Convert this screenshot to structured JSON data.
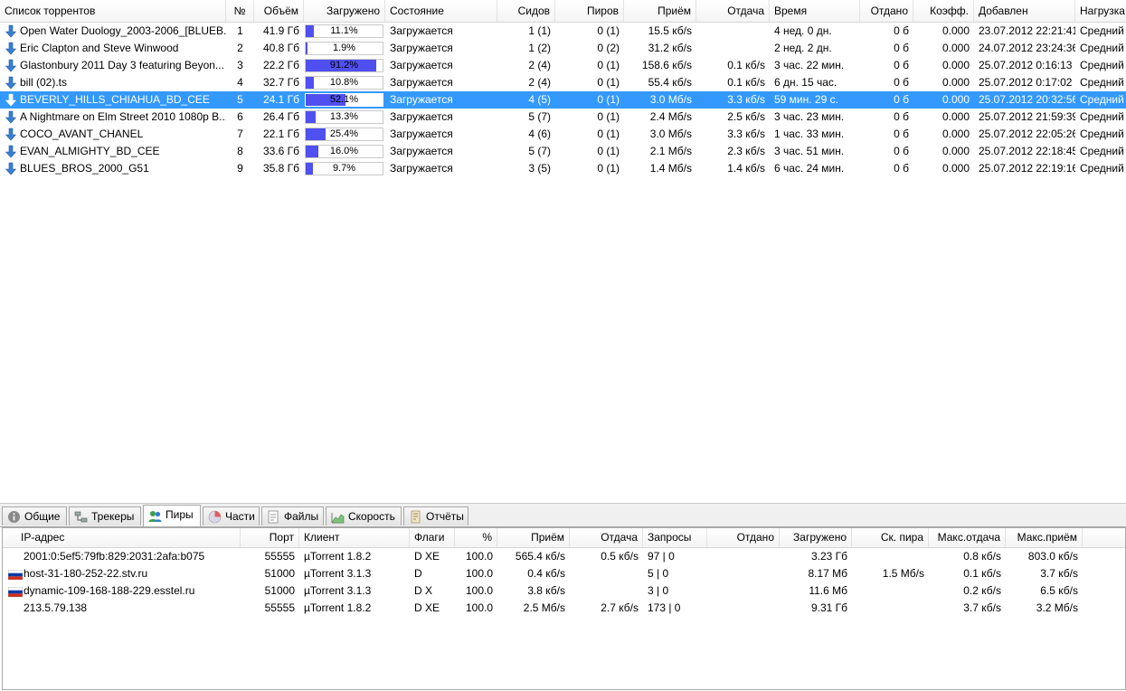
{
  "torrents": {
    "columns": {
      "name": "Список торрентов",
      "num": "№",
      "size": "Объём",
      "done": "Загружено",
      "status": "Состояние",
      "seeds": "Сидов",
      "peers": "Пиров",
      "down": "Приём",
      "up": "Отдача",
      "eta": "Время",
      "uploaded": "Отдано",
      "ratio": "Коэфф.",
      "added": "Добавлен",
      "load": "Нагрузка"
    },
    "rows": [
      {
        "name": "Open Water Duology_2003-2006_[BLUEB...",
        "num": "1",
        "size": "41.9 Гб",
        "progress": 11.1,
        "done": "11.1%",
        "status": "Загружается",
        "seeds": "1 (1)",
        "peers": "0 (1)",
        "down": "15.5 кб/s",
        "up": "",
        "eta": "4 нед. 0 дн.",
        "uploaded": "0 б",
        "ratio": "0.000",
        "added": "23.07.2012 22:21:41",
        "load": "Средний"
      },
      {
        "name": "Eric Clapton and Steve Winwood",
        "num": "2",
        "size": "40.8 Гб",
        "progress": 1.9,
        "done": "1.9%",
        "status": "Загружается",
        "seeds": "1 (2)",
        "peers": "0 (2)",
        "down": "31.2 кб/s",
        "up": "",
        "eta": "2 нед. 2 дн.",
        "uploaded": "0 б",
        "ratio": "0.000",
        "added": "24.07.2012 23:24:36",
        "load": "Средний"
      },
      {
        "name": "Glastonbury 2011 Day 3 featuring Beyon...",
        "num": "3",
        "size": "22.2 Гб",
        "progress": 91.2,
        "done": "91.2%",
        "status": "Загружается",
        "seeds": "2 (4)",
        "peers": "0 (1)",
        "down": "158.6 кб/s",
        "up": "0.1 кб/s",
        "eta": "3 час. 22 мин.",
        "uploaded": "0 б",
        "ratio": "0.000",
        "added": "25.07.2012 0:16:13",
        "load": "Средний"
      },
      {
        "name": "bill (02).ts",
        "num": "4",
        "size": "32.7 Гб",
        "progress": 10.8,
        "done": "10.8%",
        "status": "Загружается",
        "seeds": "2 (4)",
        "peers": "0 (1)",
        "down": "55.4 кб/s",
        "up": "0.1 кб/s",
        "eta": "6 дн. 15 час.",
        "uploaded": "0 б",
        "ratio": "0.000",
        "added": "25.07.2012 0:17:02",
        "load": "Средний"
      },
      {
        "name": "BEVERLY_HILLS_CHIAHUA_BD_CEE",
        "num": "5",
        "size": "24.1 Гб",
        "progress": 52.1,
        "done": "52.1%",
        "status": "Загружается",
        "seeds": "4 (5)",
        "peers": "0 (1)",
        "down": "3.0 Мб/s",
        "up": "3.3 кб/s",
        "eta": "59 мин. 29 с.",
        "uploaded": "0 б",
        "ratio": "0.000",
        "added": "25.07.2012 20:32:56",
        "load": "Средний",
        "selected": true
      },
      {
        "name": "A Nightmare on Elm Street 2010 1080p B...",
        "num": "6",
        "size": "26.4 Гб",
        "progress": 13.3,
        "done": "13.3%",
        "status": "Загружается",
        "seeds": "5 (7)",
        "peers": "0 (1)",
        "down": "2.4 Мб/s",
        "up": "2.5 кб/s",
        "eta": "3 час. 23 мин.",
        "uploaded": "0 б",
        "ratio": "0.000",
        "added": "25.07.2012 21:59:39",
        "load": "Средний"
      },
      {
        "name": "COCO_AVANT_CHANEL",
        "num": "7",
        "size": "22.1 Гб",
        "progress": 25.4,
        "done": "25.4%",
        "status": "Загружается",
        "seeds": "4 (6)",
        "peers": "0 (1)",
        "down": "3.0 Мб/s",
        "up": "3.3 кб/s",
        "eta": "1 час. 33 мин.",
        "uploaded": "0 б",
        "ratio": "0.000",
        "added": "25.07.2012 22:05:26",
        "load": "Средний"
      },
      {
        "name": "EVAN_ALMIGHTY_BD_CEE",
        "num": "8",
        "size": "33.6 Гб",
        "progress": 16.0,
        "done": "16.0%",
        "status": "Загружается",
        "seeds": "5 (7)",
        "peers": "0 (1)",
        "down": "2.1 Мб/s",
        "up": "2.3 кб/s",
        "eta": "3 час. 51 мин.",
        "uploaded": "0 б",
        "ratio": "0.000",
        "added": "25.07.2012 22:18:45",
        "load": "Средний"
      },
      {
        "name": "BLUES_BROS_2000_G51",
        "num": "9",
        "size": "35.8 Гб",
        "progress": 9.7,
        "done": "9.7%",
        "status": "Загружается",
        "seeds": "3 (5)",
        "peers": "0 (1)",
        "down": "1.4 Мб/s",
        "up": "1.4 кб/s",
        "eta": "6 час. 24 мин.",
        "uploaded": "0 б",
        "ratio": "0.000",
        "added": "25.07.2012 22:19:16",
        "load": "Средний"
      }
    ]
  },
  "tabs": [
    {
      "label": "Общие",
      "icon": "info-icon"
    },
    {
      "label": "Трекеры",
      "icon": "network-icon"
    },
    {
      "label": "Пиры",
      "icon": "users-icon",
      "active": true
    },
    {
      "label": "Части",
      "icon": "pie-icon"
    },
    {
      "label": "Файлы",
      "icon": "folder-icon"
    },
    {
      "label": "Скорость",
      "icon": "speed-graph-icon"
    },
    {
      "label": "Отчёты",
      "icon": "log-icon"
    }
  ],
  "peers": {
    "columns": {
      "ip": "IP-адрес",
      "port": "Порт",
      "client": "Клиент",
      "flags": "Флаги",
      "pct": "%",
      "down": "Приём",
      "up": "Отдача",
      "reqs": "Запросы",
      "uploaded": "Отдано",
      "downloaded": "Загружено",
      "peer_speed": "Ск. пира",
      "max_up": "Макс.отдача",
      "max_down": "Макс.приём"
    },
    "rows": [
      {
        "flag": "",
        "ip": "2001:0:5ef5:79fb:829:2031:2afa:b075",
        "port": "55555",
        "client": "µTorrent 1.8.2",
        "flags": "D XE",
        "pct": "100.0",
        "down": "565.4 кб/s",
        "up": "0.5 кб/s",
        "reqs": "97 | 0",
        "uploaded": "",
        "downloaded": "3.23 Гб",
        "peer_speed": "",
        "max_up": "0.8 кб/s",
        "max_down": "803.0 кб/s"
      },
      {
        "flag": "ru",
        "ip": "host-31-180-252-22.stv.ru",
        "port": "51000",
        "client": "µTorrent 3.1.3",
        "flags": "D",
        "pct": "100.0",
        "down": "0.4 кб/s",
        "up": "",
        "reqs": "5 | 0",
        "uploaded": "",
        "downloaded": "8.17 Мб",
        "peer_speed": "1.5 Мб/s",
        "max_up": "0.1 кб/s",
        "max_down": "3.7 кб/s"
      },
      {
        "flag": "ru",
        "ip": "dynamic-109-168-188-229.esstel.ru",
        "port": "51000",
        "client": "µTorrent 3.1.3",
        "flags": "D X",
        "pct": "100.0",
        "down": "3.8 кб/s",
        "up": "",
        "reqs": "3 | 0",
        "uploaded": "",
        "downloaded": "11.6 Мб",
        "peer_speed": "",
        "max_up": "0.2 кб/s",
        "max_down": "6.5 кб/s"
      },
      {
        "flag": "",
        "ip": "213.5.79.138",
        "port": "55555",
        "client": "µTorrent 1.8.2",
        "flags": "D XE",
        "pct": "100.0",
        "down": "2.5 Мб/s",
        "up": "2.7 кб/s",
        "reqs": "173 | 0",
        "uploaded": "",
        "downloaded": "9.31 Гб",
        "peer_speed": "",
        "max_up": "3.7 кб/s",
        "max_down": "3.2 Мб/s"
      }
    ]
  },
  "colors": {
    "selection": "#3399ff",
    "progress_fill": "#5050f0",
    "flag_ru": [
      "#ffffff",
      "#0039a6",
      "#d52b1e"
    ]
  }
}
